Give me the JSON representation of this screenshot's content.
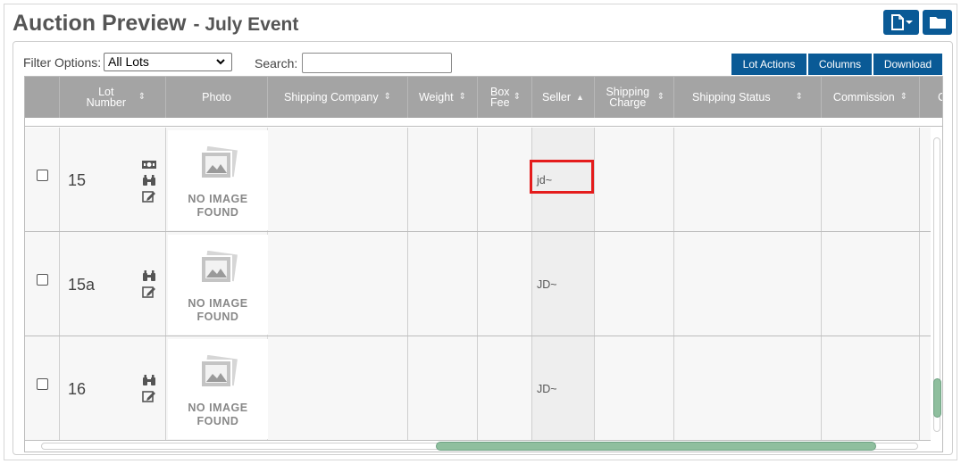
{
  "header": {
    "title": "Auction Preview",
    "subtitle": "- July Event",
    "new_doc_icon": "file-dropdown-icon",
    "folder_icon": "folder-icon"
  },
  "toolbar": {
    "filter_label": "Filter Options:",
    "filter_value": "All Lots",
    "search_label": "Search:",
    "search_value": "",
    "lot_actions_label": "Lot Actions",
    "columns_label": "Columns",
    "download_label": "Download"
  },
  "table": {
    "columns": [
      {
        "label": "Lot Number",
        "sortable": true
      },
      {
        "label": "Photo",
        "sortable": false
      },
      {
        "label": "Shipping Company",
        "sortable": true
      },
      {
        "label": "Weight",
        "sortable": true
      },
      {
        "label": "Box Fee",
        "sortable": true
      },
      {
        "label": "Seller",
        "sortable": true,
        "sorted": "ascending"
      },
      {
        "label": "Shipping Charge",
        "sortable": true
      },
      {
        "label": "Shipping Status",
        "sortable": true
      },
      {
        "label": "Commission",
        "sortable": true
      },
      {
        "label": "C",
        "sortable": false
      }
    ],
    "rows": [
      {
        "lot": "15",
        "photo_text": [
          "NO IMAGE",
          "FOUND"
        ],
        "shipping_company": "",
        "weight": "",
        "box_fee": "",
        "seller": "jd~",
        "shipping_charge": "",
        "shipping_status": "",
        "commission": "",
        "icons": [
          "money-icon",
          "binoculars-icon",
          "edit-icon"
        ],
        "highlighted": true
      },
      {
        "lot": "15a",
        "photo_text": [
          "NO IMAGE",
          "FOUND"
        ],
        "shipping_company": "",
        "weight": "",
        "box_fee": "",
        "seller": "JD~",
        "shipping_charge": "",
        "shipping_status": "",
        "commission": "",
        "icons": [
          "binoculars-icon",
          "edit-icon"
        ],
        "highlighted": false
      },
      {
        "lot": "16",
        "photo_text": [
          "NO IMAGE",
          "FOUND"
        ],
        "shipping_company": "",
        "weight": "",
        "box_fee": "",
        "seller": "JD~",
        "shipping_charge": "",
        "shipping_status": "",
        "commission": "",
        "icons": [
          "binoculars-icon",
          "edit-icon"
        ],
        "highlighted": false
      }
    ]
  },
  "colors": {
    "brand": "#0a5a96",
    "header_bg": "#a4a4a4",
    "highlight": "#e41c1c",
    "scroll_thumb": "#8fbf9e"
  }
}
